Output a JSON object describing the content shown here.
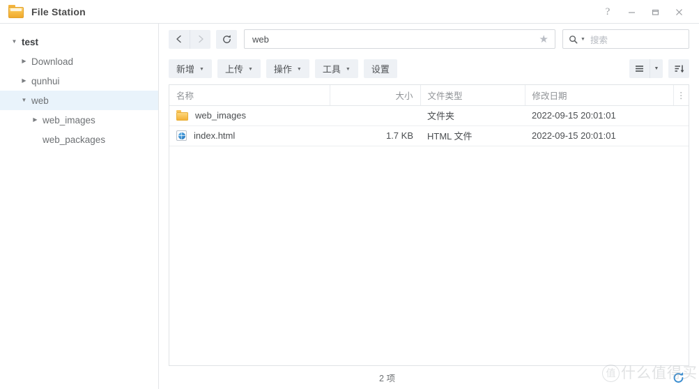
{
  "window": {
    "title": "File Station",
    "icon": "folder-icon",
    "controls": {
      "help": "?",
      "minimize": "minimize-icon",
      "maximize": "maximize-icon",
      "close": "close-icon"
    }
  },
  "sidebar": {
    "items": [
      {
        "label": "test",
        "indent": 0,
        "expanded": true,
        "hasChildren": true,
        "selected": false,
        "root": true
      },
      {
        "label": "Download",
        "indent": 1,
        "expanded": false,
        "hasChildren": true,
        "selected": false,
        "root": false
      },
      {
        "label": "qunhui",
        "indent": 1,
        "expanded": false,
        "hasChildren": true,
        "selected": false,
        "root": false
      },
      {
        "label": "web",
        "indent": 1,
        "expanded": true,
        "hasChildren": true,
        "selected": true,
        "root": false
      },
      {
        "label": "web_images",
        "indent": 2,
        "expanded": false,
        "hasChildren": true,
        "selected": false,
        "root": false
      },
      {
        "label": "web_packages",
        "indent": 2,
        "expanded": false,
        "hasChildren": false,
        "selected": false,
        "root": false
      }
    ]
  },
  "navbar": {
    "back_icon": "chevron-left-icon",
    "forward_icon": "chevron-right-icon",
    "refresh_icon": "refresh-icon",
    "address_value": "web",
    "favorite_icon": "star-icon",
    "search_icon": "search-icon",
    "search_placeholder": "搜索"
  },
  "toolbar": {
    "buttons": [
      {
        "label": "新增",
        "dropdown": true
      },
      {
        "label": "上传",
        "dropdown": true
      },
      {
        "label": "操作",
        "dropdown": true
      },
      {
        "label": "工具",
        "dropdown": true
      },
      {
        "label": "设置",
        "dropdown": false
      }
    ],
    "view_icon": "list-view-icon",
    "view_caret": "chevron-down-icon",
    "sort_icon": "sort-descending-icon"
  },
  "table": {
    "columns": [
      {
        "key": "name",
        "label": "名称"
      },
      {
        "key": "size",
        "label": "大小"
      },
      {
        "key": "type",
        "label": "文件类型"
      },
      {
        "key": "date",
        "label": "修改日期"
      }
    ],
    "menu_icon": "⋮",
    "rows": [
      {
        "icon": "folder-icon",
        "name": "web_images",
        "size": "",
        "type": "文件夹",
        "date": "2022-09-15 20:01:01"
      },
      {
        "icon": "html-file-icon",
        "name": "index.html",
        "size": "1.7 KB",
        "type": "HTML 文件",
        "date": "2022-09-15 20:01:01"
      }
    ]
  },
  "statusbar": {
    "item_count": "2 项",
    "refresh_icon": "refresh-circle-icon"
  },
  "watermark": {
    "badge": "值",
    "text": "什么值得买"
  },
  "colors": {
    "accent": "#3e8fd0",
    "selection": "#e9f3fb",
    "button": "#eef1f5",
    "folder": "#f8c254",
    "border": "#e0e3e6"
  }
}
